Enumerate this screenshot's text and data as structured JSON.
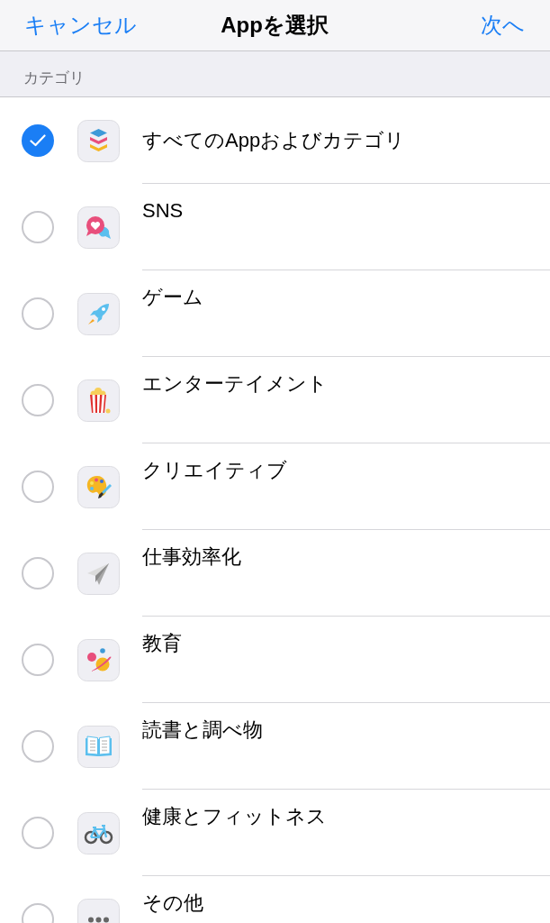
{
  "nav_bar": {
    "cancel": "キャンセル",
    "title": "Appを選択",
    "next": "次へ"
  },
  "section_header": "カテゴリ",
  "categories": [
    {
      "label": "すべてのAppおよびカテゴリ",
      "kind": "all",
      "selected": true
    },
    {
      "label": "SNS",
      "kind": "category",
      "selected": false
    },
    {
      "label": "ゲーム",
      "kind": "category",
      "selected": false
    },
    {
      "label": "エンターテイメント",
      "kind": "category",
      "selected": false
    },
    {
      "label": "クリエイティブ",
      "kind": "category",
      "selected": false
    },
    {
      "label": "仕事効率化",
      "kind": "category",
      "selected": false
    },
    {
      "label": "教育",
      "kind": "category",
      "selected": false
    },
    {
      "label": "読書と調べ物",
      "kind": "category",
      "selected": false
    },
    {
      "label": "健康とフィットネス",
      "kind": "category",
      "selected": false
    },
    {
      "label": "その他",
      "kind": "category",
      "selected": false
    }
  ]
}
